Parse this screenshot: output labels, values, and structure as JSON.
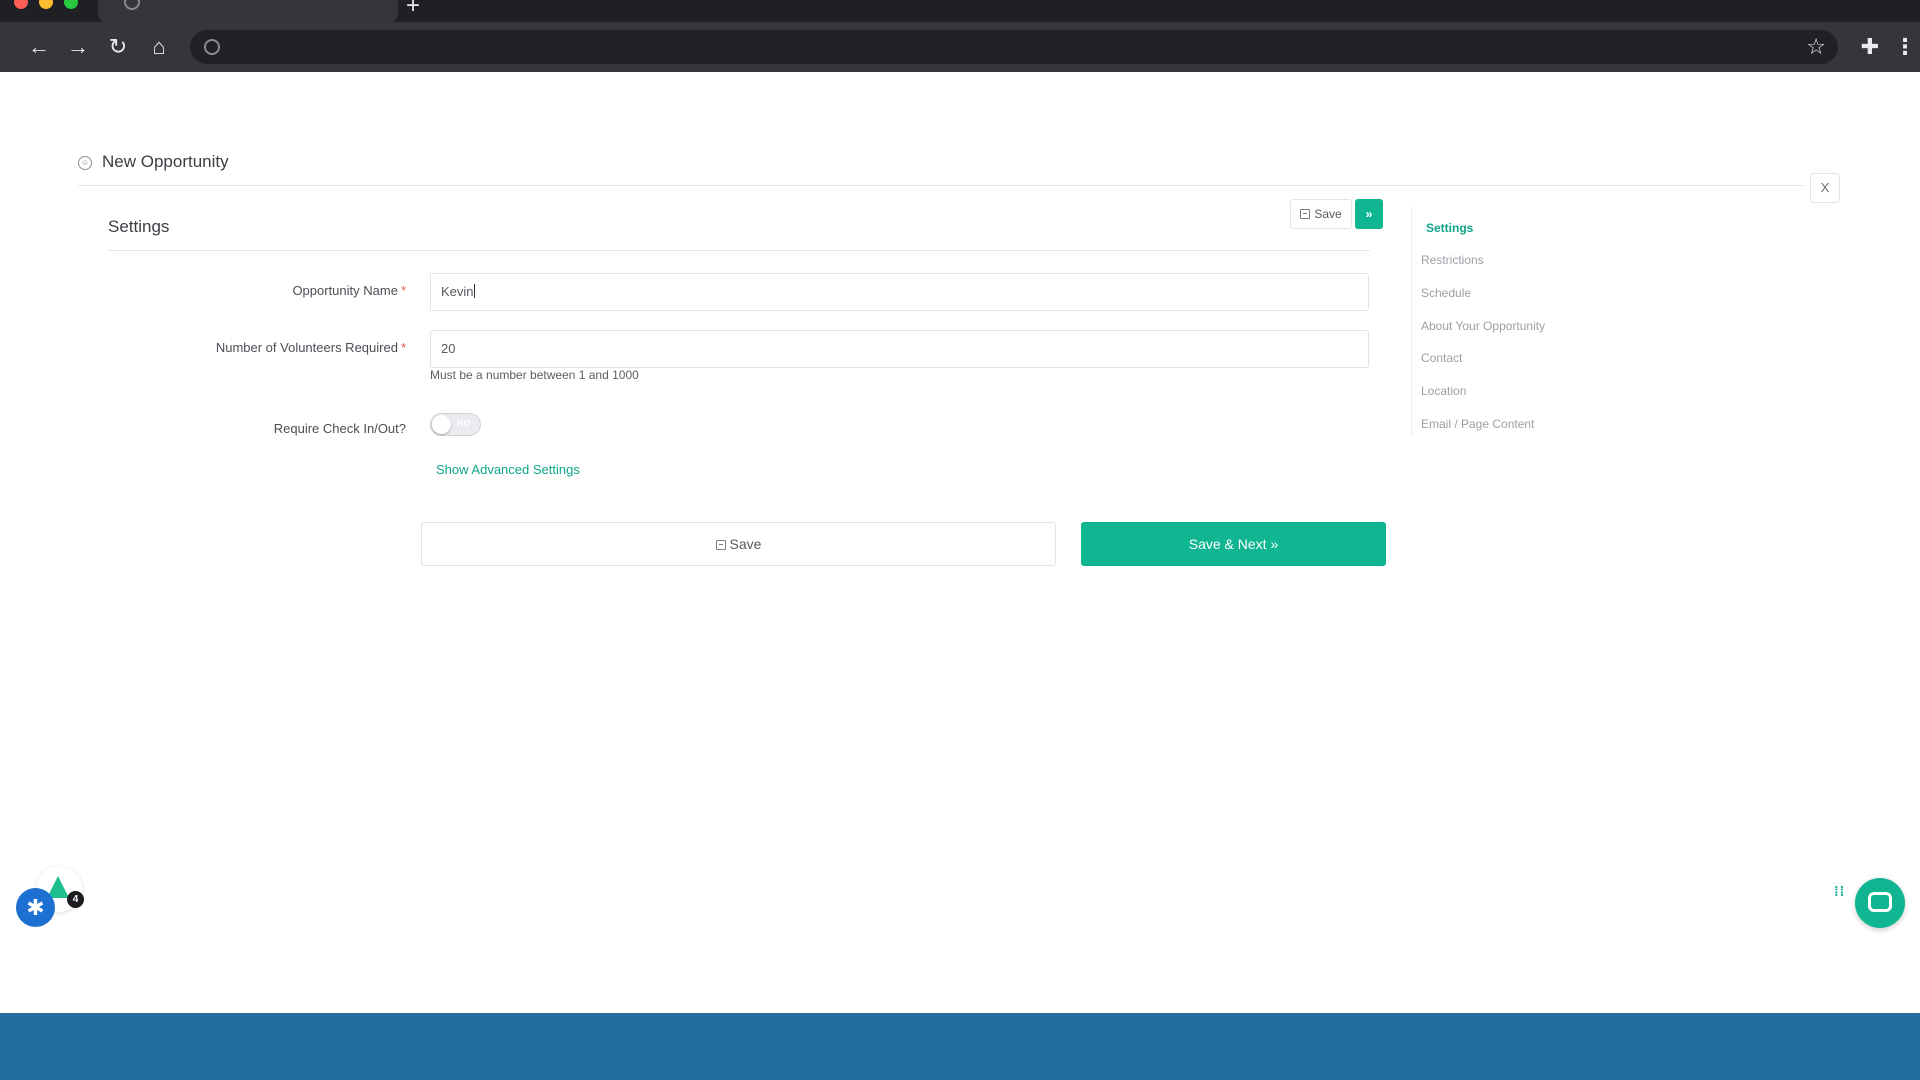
{
  "header": {
    "title": "New Opportunity",
    "close_label": "X"
  },
  "section": {
    "title": "Settings"
  },
  "toolbar": {
    "save_label": "Save",
    "next_label": "»"
  },
  "form": {
    "opportunity_name": {
      "label": "Opportunity Name",
      "required": "*",
      "value": "Kevin"
    },
    "volunteers": {
      "label": "Number of Volunteers Required",
      "required": "*",
      "value": "20",
      "hint": "Must be a number between 1 and 1000"
    },
    "check_in": {
      "label": "Require Check In/Out?",
      "toggle_text": "NO"
    },
    "advanced_link": "Show Advanced Settings"
  },
  "actions": {
    "save_label": "Save",
    "save_next_label": "Save & Next »"
  },
  "side_nav": {
    "items": [
      {
        "label": "Settings",
        "active": true
      },
      {
        "label": "Restrictions"
      },
      {
        "label": "Schedule"
      },
      {
        "label": "About Your Opportunity"
      },
      {
        "label": "Contact"
      },
      {
        "label": "Location"
      },
      {
        "label": "Email / Page Content"
      }
    ]
  },
  "widgets": {
    "badge_count": "4"
  },
  "colors": {
    "accent": "#10b591",
    "footer": "#226f9f",
    "link": "#10a58a"
  }
}
